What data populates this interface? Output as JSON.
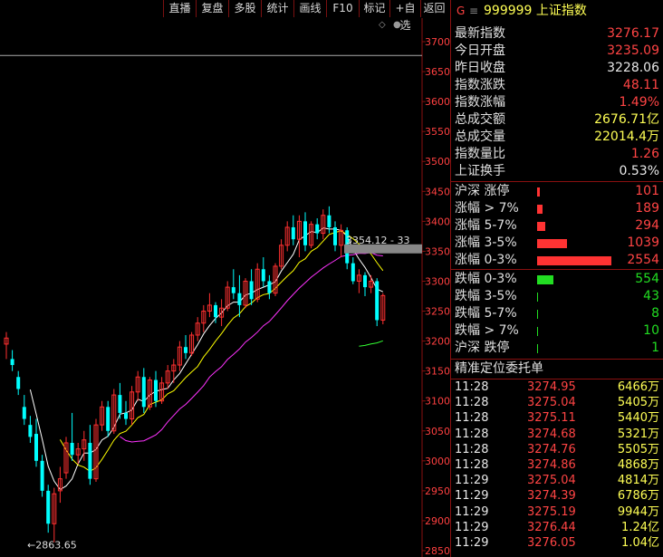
{
  "toolbar": {
    "buttons": [
      "直播",
      "复盘",
      "多股",
      "统计",
      "画线",
      "F10",
      "标记",
      "+自选",
      "返回"
    ]
  },
  "chart": {
    "y_ticks": [
      "3700",
      "3650",
      "3600",
      "3550",
      "3500",
      "3450",
      "3400",
      "3350",
      "3300",
      "3250",
      "3200",
      "3150",
      "3100",
      "3050",
      "3000",
      "2950",
      "2900",
      "2850"
    ],
    "low_label": "←2863.65",
    "tooltip_label": "3354.12 - 33",
    "colors": {
      "up": "#ff3030",
      "down": "#00ffff",
      "ma_white": "#ffffff",
      "ma_yellow": "#ffff00",
      "ma_magenta": "#ff33ff",
      "ma_green": "#33ff33"
    }
  },
  "chart_data": {
    "type": "candlestick",
    "ylim": [
      2845,
      3725
    ],
    "reference_line": 3677,
    "candles": [
      {
        "o": 3195,
        "h": 3215,
        "l": 3170,
        "c": 3205
      },
      {
        "o": 3170,
        "h": 3185,
        "l": 3150,
        "c": 3160
      },
      {
        "o": 3140,
        "h": 3150,
        "l": 3110,
        "c": 3120
      },
      {
        "o": 3090,
        "h": 3110,
        "l": 3060,
        "c": 3070
      },
      {
        "o": 3060,
        "h": 3075,
        "l": 3030,
        "c": 3040
      },
      {
        "o": 3045,
        "h": 3070,
        "l": 2990,
        "c": 3000
      },
      {
        "o": 3000,
        "h": 3010,
        "l": 2940,
        "c": 2950
      },
      {
        "o": 2950,
        "h": 2960,
        "l": 2880,
        "c": 2895
      },
      {
        "o": 2895,
        "h": 2955,
        "l": 2864,
        "c": 2945
      },
      {
        "o": 2950,
        "h": 2990,
        "l": 2930,
        "c": 2970
      },
      {
        "o": 2980,
        "h": 3040,
        "l": 2970,
        "c": 3030
      },
      {
        "o": 3030,
        "h": 3080,
        "l": 3000,
        "c": 3010
      },
      {
        "o": 3010,
        "h": 3030,
        "l": 2995,
        "c": 3020
      },
      {
        "o": 3020,
        "h": 3050,
        "l": 3000,
        "c": 3035
      },
      {
        "o": 3030,
        "h": 3060,
        "l": 2960,
        "c": 2970
      },
      {
        "o": 2970,
        "h": 3070,
        "l": 2965,
        "c": 3060
      },
      {
        "o": 3060,
        "h": 3100,
        "l": 3050,
        "c": 3090
      },
      {
        "o": 3090,
        "h": 3100,
        "l": 3040,
        "c": 3050
      },
      {
        "o": 3050,
        "h": 3120,
        "l": 3045,
        "c": 3110
      },
      {
        "o": 3110,
        "h": 3130,
        "l": 3070,
        "c": 3080
      },
      {
        "o": 3080,
        "h": 3100,
        "l": 3060,
        "c": 3070
      },
      {
        "o": 3070,
        "h": 3125,
        "l": 3060,
        "c": 3115
      },
      {
        "o": 3115,
        "h": 3150,
        "l": 3100,
        "c": 3140
      },
      {
        "o": 3140,
        "h": 3155,
        "l": 3080,
        "c": 3090
      },
      {
        "o": 3090,
        "h": 3140,
        "l": 3085,
        "c": 3135
      },
      {
        "o": 3135,
        "h": 3150,
        "l": 3090,
        "c": 3100
      },
      {
        "o": 3100,
        "h": 3140,
        "l": 3095,
        "c": 3130
      },
      {
        "o": 3130,
        "h": 3160,
        "l": 3120,
        "c": 3150
      },
      {
        "o": 3150,
        "h": 3170,
        "l": 3130,
        "c": 3160
      },
      {
        "o": 3160,
        "h": 3200,
        "l": 3150,
        "c": 3190
      },
      {
        "o": 3190,
        "h": 3210,
        "l": 3170,
        "c": 3180
      },
      {
        "o": 3180,
        "h": 3215,
        "l": 3175,
        "c": 3210
      },
      {
        "o": 3210,
        "h": 3240,
        "l": 3200,
        "c": 3230
      },
      {
        "o": 3230,
        "h": 3260,
        "l": 3215,
        "c": 3250
      },
      {
        "o": 3250,
        "h": 3280,
        "l": 3240,
        "c": 3260
      },
      {
        "o": 3260,
        "h": 3265,
        "l": 3230,
        "c": 3240
      },
      {
        "o": 3240,
        "h": 3270,
        "l": 3225,
        "c": 3255
      },
      {
        "o": 3255,
        "h": 3300,
        "l": 3250,
        "c": 3290
      },
      {
        "o": 3290,
        "h": 3320,
        "l": 3270,
        "c": 3280
      },
      {
        "o": 3280,
        "h": 3310,
        "l": 3240,
        "c": 3260
      },
      {
        "o": 3260,
        "h": 3305,
        "l": 3255,
        "c": 3300
      },
      {
        "o": 3300,
        "h": 3320,
        "l": 3260,
        "c": 3270
      },
      {
        "o": 3270,
        "h": 3330,
        "l": 3265,
        "c": 3320
      },
      {
        "o": 3320,
        "h": 3340,
        "l": 3290,
        "c": 3300
      },
      {
        "o": 3300,
        "h": 3310,
        "l": 3270,
        "c": 3280
      },
      {
        "o": 3280,
        "h": 3330,
        "l": 3275,
        "c": 3325
      },
      {
        "o": 3325,
        "h": 3370,
        "l": 3320,
        "c": 3360
      },
      {
        "o": 3360,
        "h": 3400,
        "l": 3350,
        "c": 3390
      },
      {
        "o": 3390,
        "h": 3410,
        "l": 3360,
        "c": 3370
      },
      {
        "o": 3370,
        "h": 3410,
        "l": 3340,
        "c": 3400
      },
      {
        "o": 3400,
        "h": 3415,
        "l": 3350,
        "c": 3360
      },
      {
        "o": 3360,
        "h": 3400,
        "l": 3355,
        "c": 3395
      },
      {
        "o": 3395,
        "h": 3405,
        "l": 3370,
        "c": 3380
      },
      {
        "o": 3380,
        "h": 3420,
        "l": 3370,
        "c": 3410
      },
      {
        "o": 3410,
        "h": 3425,
        "l": 3380,
        "c": 3390
      },
      {
        "o": 3390,
        "h": 3400,
        "l": 3350,
        "c": 3360
      },
      {
        "o": 3360,
        "h": 3395,
        "l": 3340,
        "c": 3385
      },
      {
        "o": 3385,
        "h": 3390,
        "l": 3320,
        "c": 3330
      },
      {
        "o": 3330,
        "h": 3340,
        "l": 3295,
        "c": 3300
      },
      {
        "o": 3300,
        "h": 3320,
        "l": 3280,
        "c": 3310
      },
      {
        "o": 3310,
        "h": 3315,
        "l": 3275,
        "c": 3290
      },
      {
        "o": 3290,
        "h": 3310,
        "l": 3280,
        "c": 3300
      },
      {
        "o": 3300,
        "h": 3305,
        "l": 3225,
        "c": 3235
      },
      {
        "o": 3235,
        "h": 3280,
        "l": 3228,
        "c": 3276
      }
    ]
  },
  "panel": {
    "title_g": "G",
    "title_menu": "≡",
    "title": "999999 上证指数",
    "quote": [
      {
        "label": "最新指数",
        "value": "3276.17",
        "color": "red"
      },
      {
        "label": "今日开盘",
        "value": "3235.09",
        "color": "red"
      },
      {
        "label": "昨日收盘",
        "value": "3228.06",
        "color": "wht"
      },
      {
        "label": "指数涨跌",
        "value": "48.11",
        "color": "red"
      },
      {
        "label": "指数涨幅",
        "value": "1.49%",
        "color": "red"
      },
      {
        "label": "总成交额",
        "value": "2676.71亿",
        "color": "yel"
      },
      {
        "label": "总成交量",
        "value": "22014.4万",
        "color": "yel"
      },
      {
        "label": "指数量比",
        "value": "1.26",
        "color": "red"
      },
      {
        "label": "上证换手",
        "value": "0.53%",
        "color": "wht"
      }
    ],
    "breadth_up": [
      {
        "label": "沪深 涨停",
        "value": "101",
        "count": 101
      },
      {
        "label": "涨幅 > 7%",
        "value": "189",
        "count": 189
      },
      {
        "label": "涨幅 5-7%",
        "value": "294",
        "count": 294
      },
      {
        "label": "涨幅 3-5%",
        "value": "1039",
        "count": 1039
      },
      {
        "label": "涨幅 0-3%",
        "value": "2554",
        "count": 2554
      }
    ],
    "breadth_down": [
      {
        "label": "跌幅 0-3%",
        "value": "554",
        "count": 554
      },
      {
        "label": "跌幅 3-5%",
        "value": "43",
        "count": 43
      },
      {
        "label": "跌幅 5-7%",
        "value": "8",
        "count": 8
      },
      {
        "label": "跌幅 > 7%",
        "value": "10",
        "count": 10
      },
      {
        "label": "沪深 跌停",
        "value": "1",
        "count": 1
      }
    ],
    "orders_title": "精准定位委托单",
    "orders": [
      {
        "time": "11:28",
        "price": "3274.95",
        "vol": "6466万"
      },
      {
        "time": "11:28",
        "price": "3275.04",
        "vol": "5405万"
      },
      {
        "time": "11:28",
        "price": "3275.11",
        "vol": "5440万"
      },
      {
        "time": "11:28",
        "price": "3274.68",
        "vol": "5321万"
      },
      {
        "time": "11:28",
        "price": "3274.76",
        "vol": "5505万"
      },
      {
        "time": "11:28",
        "price": "3274.86",
        "vol": "4868万"
      },
      {
        "time": "11:29",
        "price": "3275.04",
        "vol": "4814万"
      },
      {
        "time": "11:29",
        "price": "3274.39",
        "vol": "6786万"
      },
      {
        "time": "11:29",
        "price": "3275.19",
        "vol": "9944万"
      },
      {
        "time": "11:29",
        "price": "3276.44",
        "vol": "1.24亿"
      },
      {
        "time": "11:29",
        "price": "3276.05",
        "vol": "1.04亿"
      }
    ]
  }
}
